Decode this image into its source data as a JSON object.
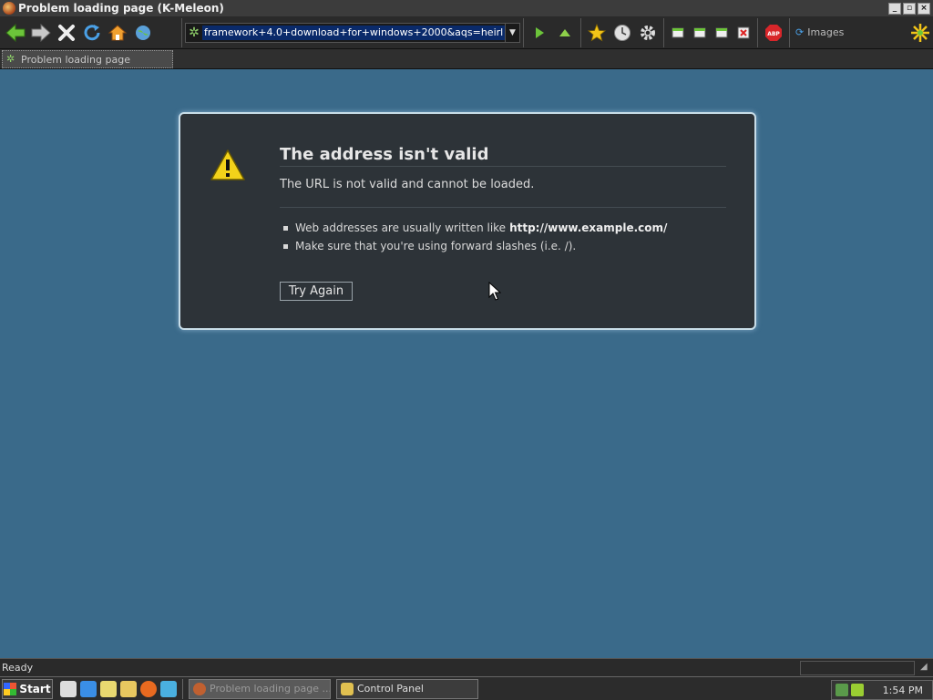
{
  "window": {
    "title": "Problem loading page (K-Meleon)",
    "controls": [
      "_",
      "▫",
      "×"
    ]
  },
  "toolbar": {
    "url": "framework+4.0+download+for+windows+2000&aqs=heirloom-srp...",
    "images_label": "Images",
    "icons": [
      "back-icon",
      "forward-icon",
      "stop-icon",
      "reload-icon",
      "home-icon",
      "globe-icon",
      "go-icon",
      "up-icon",
      "bookmark-star-icon",
      "history-icon",
      "settings-gear-icon",
      "window-icon",
      "window-icon",
      "window-icon",
      "close-window-icon",
      "adblock-icon",
      "images-icon"
    ]
  },
  "tabs": [
    {
      "label": "Problem loading page"
    }
  ],
  "error": {
    "title": "The address isn't valid",
    "description": "The URL is not valid and cannot be loaded.",
    "bullets": [
      {
        "text": "Web addresses are usually written like",
        "strong": "http://www.example.com/"
      },
      {
        "text": "Make sure that you're using forward slashes (i.e. /).",
        "strong": ""
      }
    ],
    "button": "Try Again"
  },
  "status": {
    "text": "Ready"
  },
  "taskbar": {
    "start_label": "Start",
    "tasks": [
      {
        "label": "Problem loading page ...",
        "active": true
      },
      {
        "label": "Control Panel",
        "active": false
      }
    ],
    "clock": "1:54 PM"
  }
}
